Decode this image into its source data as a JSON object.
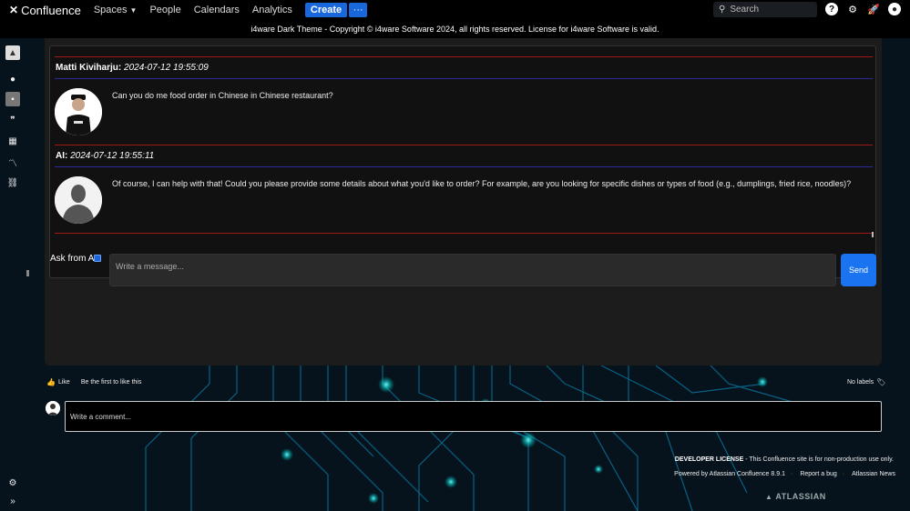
{
  "nav": {
    "logo": "Confluence",
    "spaces": "Spaces",
    "people": "People",
    "calendars": "Calendars",
    "analytics": "Analytics",
    "create": "Create",
    "more": "···",
    "search_placeholder": "Search"
  },
  "banner": "i4ware Dark Theme - Copyright © i4ware Software 2024, all rights reserved. License for i4ware Software is valid.",
  "chat": {
    "messages": [
      {
        "name": "Matti Kiviharju:",
        "time": "2024-07-12 19:55:09",
        "text": "Can you do me food order in Chinese in Chinese restaurant?"
      },
      {
        "name": "AI:",
        "time": "2024-07-12 19:55:11",
        "text": "Of course, I can help with that! Could you please provide some details about what you'd like to order? For example, are you looking for specific dishes or types of food (e.g., dumplings, fried rice, noodles)?"
      }
    ],
    "ask_label": "Ask from AI",
    "input_placeholder": "Write a message...",
    "send": "Send"
  },
  "like": {
    "label": "Like",
    "first": "Be the first to like this",
    "no_labels": "No labels"
  },
  "comment": {
    "placeholder": "Write a comment..."
  },
  "footer": {
    "license_bold": "DEVELOPER LICENSE",
    "license_rest": " - This Confluence site is for non-production use only.",
    "powered": "Powered by Atlassian Confluence 8.9.1",
    "report": "Report a bug",
    "news": "Atlassian News",
    "brand": "ATLASSIAN"
  },
  "colors": {
    "accent": "#1868db",
    "send": "#1a73f0",
    "rule_red": "#a01818",
    "rule_blue": "#2a2a9a"
  }
}
